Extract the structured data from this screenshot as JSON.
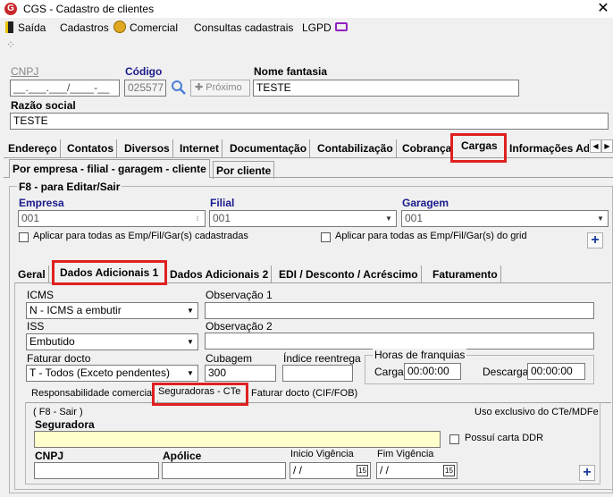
{
  "window": {
    "title": "CGS - Cadastro de clientes"
  },
  "menu": {
    "saida": "Saída",
    "cadastros": "Cadastros",
    "comercial": "Comercial",
    "consultas": "Consultas cadastrais",
    "lgpd": "LGPD"
  },
  "header": {
    "cnpj_label": "CNPJ",
    "cnpj_value": "__.___.___/____-__",
    "codigo_label": "Código",
    "codigo_value": "025577",
    "proximo_label": "Próximo",
    "fantasia_label": "Nome fantasia",
    "fantasia_value": "TESTE",
    "razao_label": "Razão social",
    "razao_value": "TESTE"
  },
  "tabs_main": [
    "Endereço",
    "Contatos",
    "Diversos",
    "Internet",
    "Documentação",
    "Contabilização",
    "Cobrança",
    "Cargas",
    "Informações Adi"
  ],
  "tabs_sub": [
    "Por empresa - filial - garagem - cliente",
    "Por cliente"
  ],
  "group": {
    "title": "F8 - para Editar/Sair",
    "empresa_label": "Empresa",
    "empresa_value": "001",
    "filial_label": "Filial",
    "filial_value": "001",
    "garagem_label": "Garagem",
    "garagem_value": "001",
    "chk_all": "Aplicar para todas as Emp/Fil/Gar(s) cadastradas",
    "chk_grid": "Aplicar para todas as Emp/Fil/Gar(s) do grid"
  },
  "tabs_inner": [
    "Geral",
    "Dados Adicionais 1",
    "Dados Adicionais 2",
    "EDI / Desconto / Acréscimo",
    "Faturamento"
  ],
  "da1": {
    "icms_label": "ICMS",
    "icms_value": "N - ICMS a embutir",
    "obs1_label": "Observação 1",
    "iss_label": "ISS",
    "iss_value": "Embutido",
    "obs2_label": "Observação 2",
    "faturar_label": "Faturar docto",
    "faturar_value": "T - Todos (Exceto pendentes)",
    "cubagem_label": "Cubagem",
    "cubagem_value": "300",
    "reentrega_label": "Índice reentrega",
    "franquia_label": "Horas de franquias",
    "carga_label": "Carga",
    "carga_value": "00:00:00",
    "descarga_label": "Descarga",
    "descarga_value": "00:00:00"
  },
  "tabs_bottom": [
    "Responsabilidade comercial",
    "Seguradoras - CTe",
    "Faturar docto (CIF/FOB)"
  ],
  "seg": {
    "hint": "( F8 - Sair )",
    "uso": "Uso exclusivo do CTe/MDFe",
    "seguradora_label": "Seguradora",
    "possui_label": "Possuí carta DDR",
    "cnpj_label": "CNPJ",
    "apolice_label": "Apólice",
    "inicio_label": "Inicio Vigência",
    "inicio_value": " /  /",
    "fim_label": "Fim Vigência",
    "fim_value": " /  /"
  },
  "colors": {
    "accent_red": "#e02020",
    "blue_label": "#1a1a8c",
    "highlight_yellow": "#ffffcc"
  }
}
